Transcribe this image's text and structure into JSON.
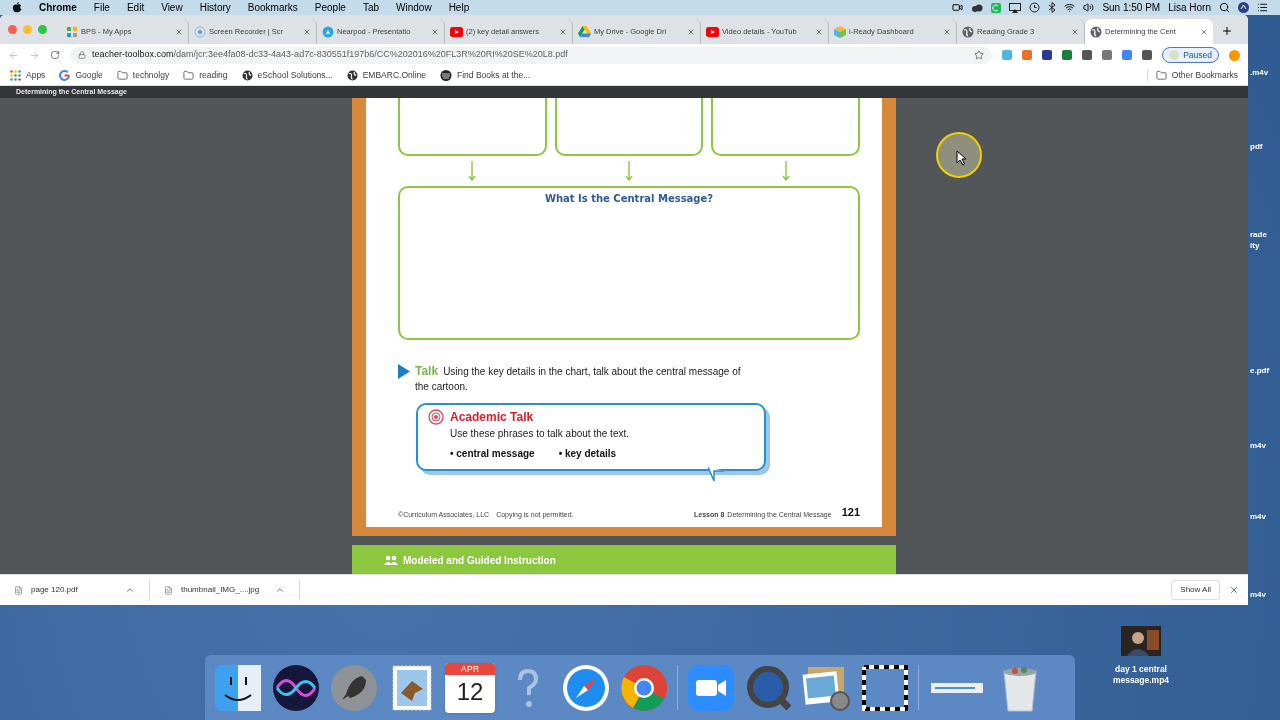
{
  "menu_bar": {
    "app": "Chrome",
    "menus": [
      "File",
      "Edit",
      "View",
      "History",
      "Bookmarks",
      "People",
      "Tab",
      "Window",
      "Help"
    ],
    "clock": "Sun 1:50 PM",
    "user": "Lisa Horn"
  },
  "browser": {
    "tabs": [
      {
        "title": "BPS - My Apps",
        "kind": "apps",
        "selected": false
      },
      {
        "title": "Screen Recorder | Scr",
        "kind": "recorder",
        "selected": false
      },
      {
        "title": "Nearpod - Presentatio",
        "kind": "nearpod",
        "selected": false
      },
      {
        "title": "(2) key detail answers",
        "kind": "youtube",
        "selected": false
      },
      {
        "title": "My Drive - Google Dri",
        "kind": "drive",
        "selected": false
      },
      {
        "title": "Video details - YouTub",
        "kind": "youtube",
        "selected": false
      },
      {
        "title": "i-Ready Dashboard",
        "kind": "iready",
        "selected": false
      },
      {
        "title": "Reading Grade 3",
        "kind": "globe",
        "selected": false
      },
      {
        "title": "Determining the Cent",
        "kind": "globe",
        "selected": true
      }
    ],
    "address": {
      "domain": "teacher-toolbox.com",
      "path": "/dam/jcr:3ee4fa08-dc33-4a43-ad7c-830551f197b6/CC%202016%20FL3R%20RI%20SE%20L8.pdf"
    },
    "profile_button": "Paused",
    "bookmarks": [
      {
        "label": "Apps",
        "kind": "apps"
      },
      {
        "label": "Google",
        "kind": "google"
      },
      {
        "label": "technolgy",
        "kind": "folder"
      },
      {
        "label": "reading",
        "kind": "folder"
      },
      {
        "label": "eSchool Solutions...",
        "kind": "globe"
      },
      {
        "label": "EMBARC.Online",
        "kind": "globe"
      },
      {
        "label": "Find Books at the...",
        "kind": "books"
      }
    ],
    "other_bookmarks": "Other Bookmarks",
    "pdf_title": "Determining the Central Message",
    "downloads": [
      {
        "name": "page 120.pdf"
      },
      {
        "name": "thumbnail_IMG_....jpg"
      }
    ],
    "show_all": "Show All"
  },
  "pdf_page": {
    "chart_title": "What Is the Central Message?",
    "talk": {
      "label": "Talk",
      "text": "Using the key details in the chart, talk about the central message of the cartoon."
    },
    "academic_talk": {
      "title": "Academic Talk",
      "instruction": "Use these phrases to talk about the text.",
      "phrases": [
        "• central message",
        "• key details"
      ]
    },
    "footer": {
      "copyright": "©Curriculum Associates, LLC",
      "notice": "Copying is not permitted.",
      "lesson": "Lesson 8",
      "lesson_title": "Determining the Central Message",
      "page_number": "121"
    }
  },
  "next_page": {
    "header": "Modeled and Guided Instruction"
  },
  "desktop": {
    "edge_labels": [
      ".m4v",
      "pdf",
      "rade",
      "ity",
      "e.pdf",
      "m4v",
      "m4v",
      "m4v"
    ],
    "file": "day 1 central message.mp4"
  },
  "dock": {
    "calendar": {
      "month": "APR",
      "day": "12"
    }
  }
}
